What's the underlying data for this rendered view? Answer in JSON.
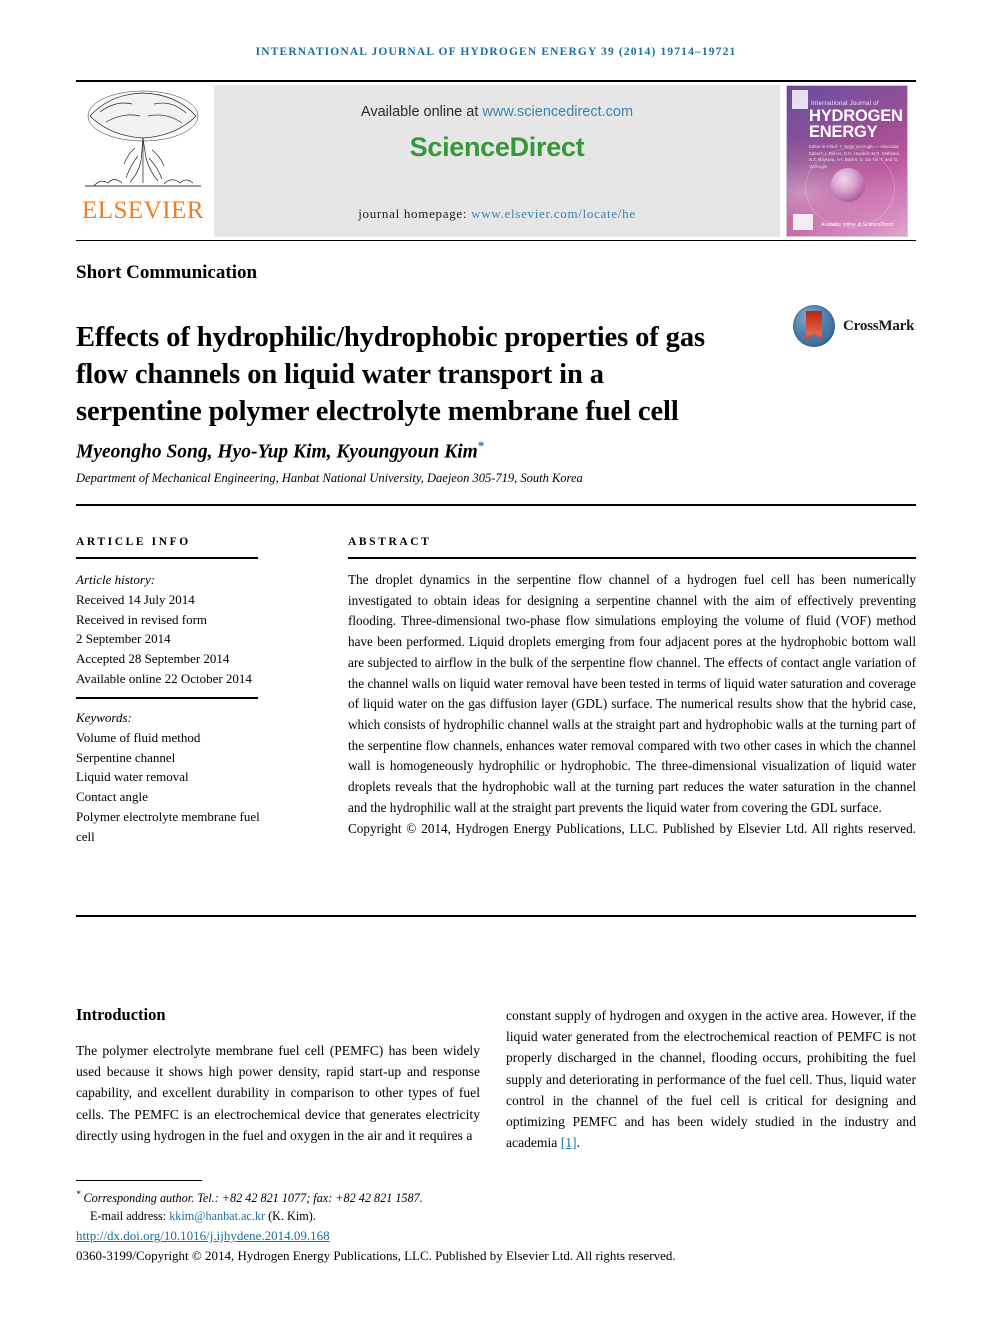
{
  "running_head": "International Journal of Hydrogen Energy 39 (2014) 19714–19721",
  "masthead": {
    "elsevier_wordmark": "ELSEVIER",
    "available_prefix": "Available online at ",
    "available_url": "www.sciencedirect.com",
    "sciencedirect_logo": "ScienceDirect",
    "homepage_prefix": "journal homepage: ",
    "homepage_url": "www.elsevier.com/locate/he",
    "cover": {
      "top_label": "International Journal of",
      "title_line1": "HYDROGEN",
      "title_line2": "ENERGY",
      "editors": "Editor-in-Chief: T. Nejat Veziroglu — Associate Editors: I. Dincer, D.O. Hayden, M.R. Mahdavi, S.Z. Baykara, I.H. Bashir, G. Da Tie, T. and G. Veziroglu",
      "sciencedirect_mark": "Available online at ScienceDirect"
    }
  },
  "article_type": "Short Communication",
  "title": "Effects of hydrophilic/hydrophobic properties of gas flow channels on liquid water transport in a serpentine polymer electrolyte membrane fuel cell",
  "crossmark_label": "CrossMark",
  "authors": "Myeongho Song, Hyo-Yup Kim, Kyoungyoun Kim",
  "author_footnote_marker": "*",
  "affiliation": "Department of Mechanical Engineering, Hanbat National University, Daejeon 305-719, South Korea",
  "article_info": {
    "heading": "ARTICLE INFO",
    "history_label": "Article history:",
    "history": [
      "Received 14 July 2014",
      "Received in revised form",
      "2 September 2014",
      "Accepted 28 September 2014",
      "Available online 22 October 2014"
    ],
    "keywords_label": "Keywords:",
    "keywords": [
      "Volume of fluid method",
      "Serpentine channel",
      "Liquid water removal",
      "Contact angle",
      "Polymer electrolyte membrane fuel cell"
    ]
  },
  "abstract": {
    "heading": "ABSTRACT",
    "body": "The droplet dynamics in the serpentine flow channel of a hydrogen fuel cell has been numerically investigated to obtain ideas for designing a serpentine channel with the aim of effectively preventing flooding. Three-dimensional two-phase flow simulations employing the volume of fluid (VOF) method have been performed. Liquid droplets emerging from four adjacent pores at the hydrophobic bottom wall are subjected to airflow in the bulk of the serpentine flow channel. The effects of contact angle variation of the channel walls on liquid water removal have been tested in terms of liquid water saturation and coverage of liquid water on the gas diffusion layer (GDL) surface. The numerical results show that the hybrid case, which consists of hydrophilic channel walls at the straight part and hydrophobic walls at the turning part of the serpentine flow channels, enhances water removal compared with two other cases in which the channel wall is homogeneously hydrophilic or hydrophobic. The three-dimensional visualization of liquid water droplets reveals that the hydrophobic wall at the turning part reduces the water saturation in the channel and the hydrophilic wall at the straight part prevents the liquid water from covering the GDL surface.",
    "copyright": "Copyright © 2014, Hydrogen Energy Publications, LLC. Published by Elsevier Ltd. All rights reserved."
  },
  "body": {
    "section_title": "Introduction",
    "left_column": "The polymer electrolyte membrane fuel cell (PEMFC) has been widely used because it shows high power density, rapid start-up and response capability, and excellent durability in comparison to other types of fuel cells. The PEMFC is an electrochemical device that generates electricity directly using hydrogen in the fuel and oxygen in the air and it requires a",
    "right_column_pre": "constant supply of hydrogen and oxygen in the active area. However, if the liquid water generated from the electrochemical reaction of PEMFC is not properly discharged in the channel, flooding occurs, prohibiting the fuel supply and deteriorating in performance of the fuel cell. Thus, liquid water control in the channel of the fuel cell is critical for designing and optimizing PEMFC and has been widely studied in the industry and academia ",
    "right_column_ref": "[1]",
    "right_column_post": "."
  },
  "footer": {
    "corresponding": "Corresponding author. Tel.: +82 42 821 1077; fax: +82 42 821 1587.",
    "email_label": "E-mail address: ",
    "email": "kkim@hanbat.ac.kr",
    "email_suffix": " (K. Kim).",
    "doi": "http://dx.doi.org/10.1016/j.ijhydene.2014.09.168",
    "issn_line": "0360-3199/Copyright © 2014, Hydrogen Energy Publications, LLC. Published by Elsevier Ltd. All rights reserved."
  },
  "colors": {
    "link": "#1a6ea0",
    "elsevier_orange": "#ee7d22",
    "sciencedirect_green": "#36973a",
    "sd_link_blue": "#3a82b5"
  }
}
